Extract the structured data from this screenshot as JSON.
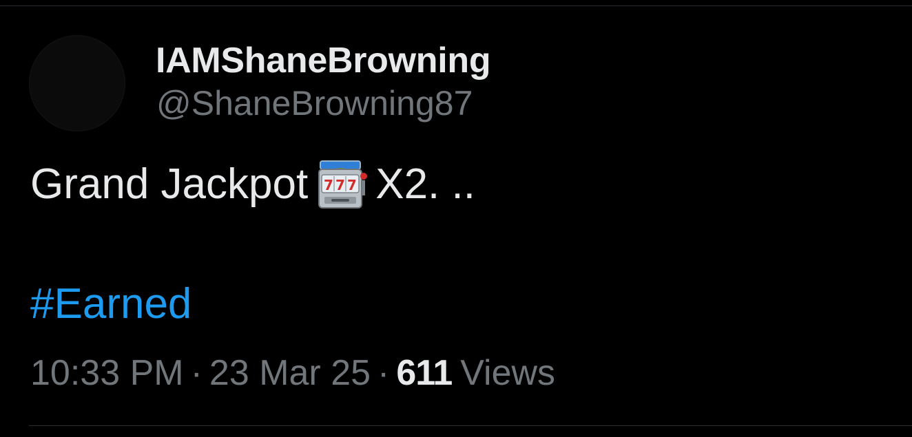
{
  "tweet": {
    "author": {
      "display_name": "IAMShaneBrowning",
      "handle": "@ShaneBrowning87"
    },
    "text_before_emoji": "Grand Jackpot",
    "emoji": "slot-machine-icon",
    "text_after_emoji": "X2. ..",
    "hashtag": "#Earned",
    "time": "10:33 PM",
    "separator": "·",
    "date": "23 Mar 25",
    "views_count": "611",
    "views_label": "Views"
  },
  "colors": {
    "background": "#000000",
    "primary_text": "#e7e9ea",
    "secondary_text": "#71767b",
    "link": "#1d9bf0",
    "divider": "#2a2d31"
  }
}
